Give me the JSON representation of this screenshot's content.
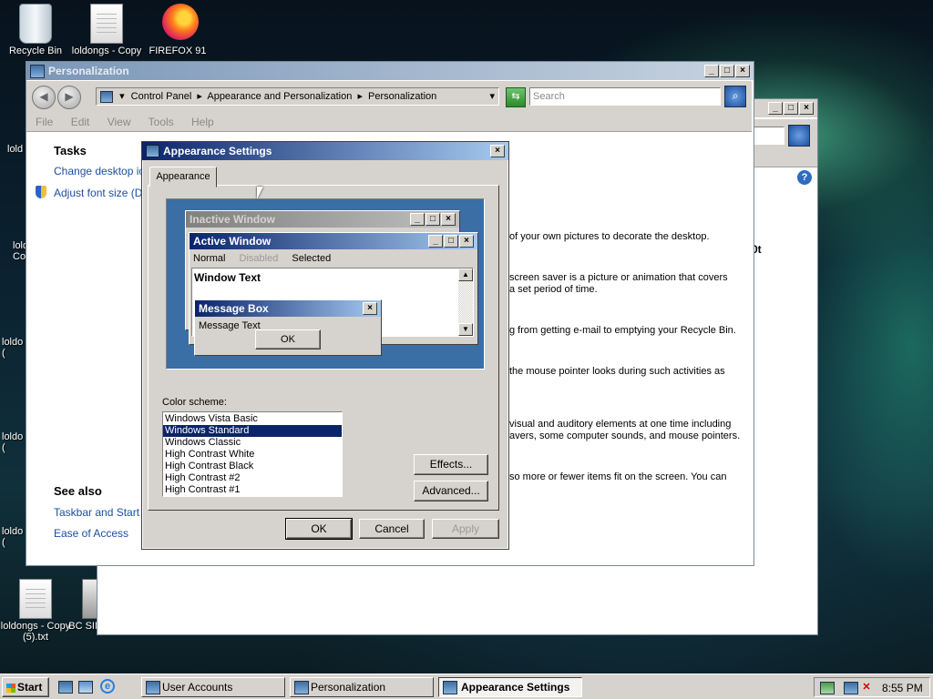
{
  "desktop": {
    "icons": [
      {
        "label": "Recycle Bin"
      },
      {
        "label": "loldongs - Copy"
      },
      {
        "label": "FIREFOX 91"
      },
      {
        "label": "loldongs - Copy (5).txt"
      },
      {
        "label": "BC SIMULATOR"
      }
    ],
    "partial_labels": [
      "lold",
      "lold Co",
      "loldo (",
      "loldo (",
      "loldo ("
    ]
  },
  "back_window": {
    "fragments": [
      "0t"
    ]
  },
  "personalization": {
    "title": "Personalization",
    "address": {
      "root": "Control Panel",
      "sep1": "▸",
      "mid": "Appearance and Personalization",
      "sep2": "▸",
      "leaf": "Personalization"
    },
    "search_placeholder": "Search",
    "menu": [
      "File",
      "Edit",
      "View",
      "Tools",
      "Help"
    ],
    "tasks_heading": "Tasks",
    "tasks": [
      "Change desktop icons",
      "Adjust font size (DPI)"
    ],
    "see_also_heading": "See also",
    "see_also": [
      "Taskbar and Start Menu",
      "Ease of Access"
    ],
    "descriptions": [
      "of your own pictures to decorate the desktop.",
      "screen saver is a picture or animation that covers",
      "a set period of time.",
      "g from getting e-mail to emptying your Recycle Bin.",
      "the mouse pointer looks during such activities as",
      "visual and auditory elements at one time including",
      "avers, some computer sounds, and mouse pointers.",
      "so more or fewer items fit on the screen. You can"
    ]
  },
  "appearance": {
    "title": "Appearance Settings",
    "tab": "Appearance",
    "preview": {
      "inactive_title": "Inactive Window",
      "active_title": "Active Window",
      "menu_normal": "Normal",
      "menu_disabled": "Disabled",
      "menu_selected": "Selected",
      "window_text": "Window Text",
      "msgbox_title": "Message Box",
      "msgbox_text": "Message Text",
      "msgbox_ok": "OK"
    },
    "color_scheme_label": "Color scheme:",
    "schemes": [
      "Windows Vista Basic",
      "Windows Standard",
      "Windows Classic",
      "High Contrast White",
      "High Contrast Black",
      "High Contrast #2",
      "High Contrast #1"
    ],
    "selected_scheme": "Windows Standard",
    "effects_button": "Effects...",
    "advanced_button": "Advanced...",
    "ok_button": "OK",
    "cancel_button": "Cancel",
    "apply_button": "Apply"
  },
  "taskbar": {
    "start": "Start",
    "tasks": [
      "User Accounts",
      "Personalization",
      "Appearance Settings"
    ],
    "clock": "8:55 PM"
  },
  "colors": {
    "title_active": "#0a246a",
    "title_inactive": "#7a96b8",
    "preview_bg": "#3a6ea5",
    "selection": "#0a246a"
  }
}
